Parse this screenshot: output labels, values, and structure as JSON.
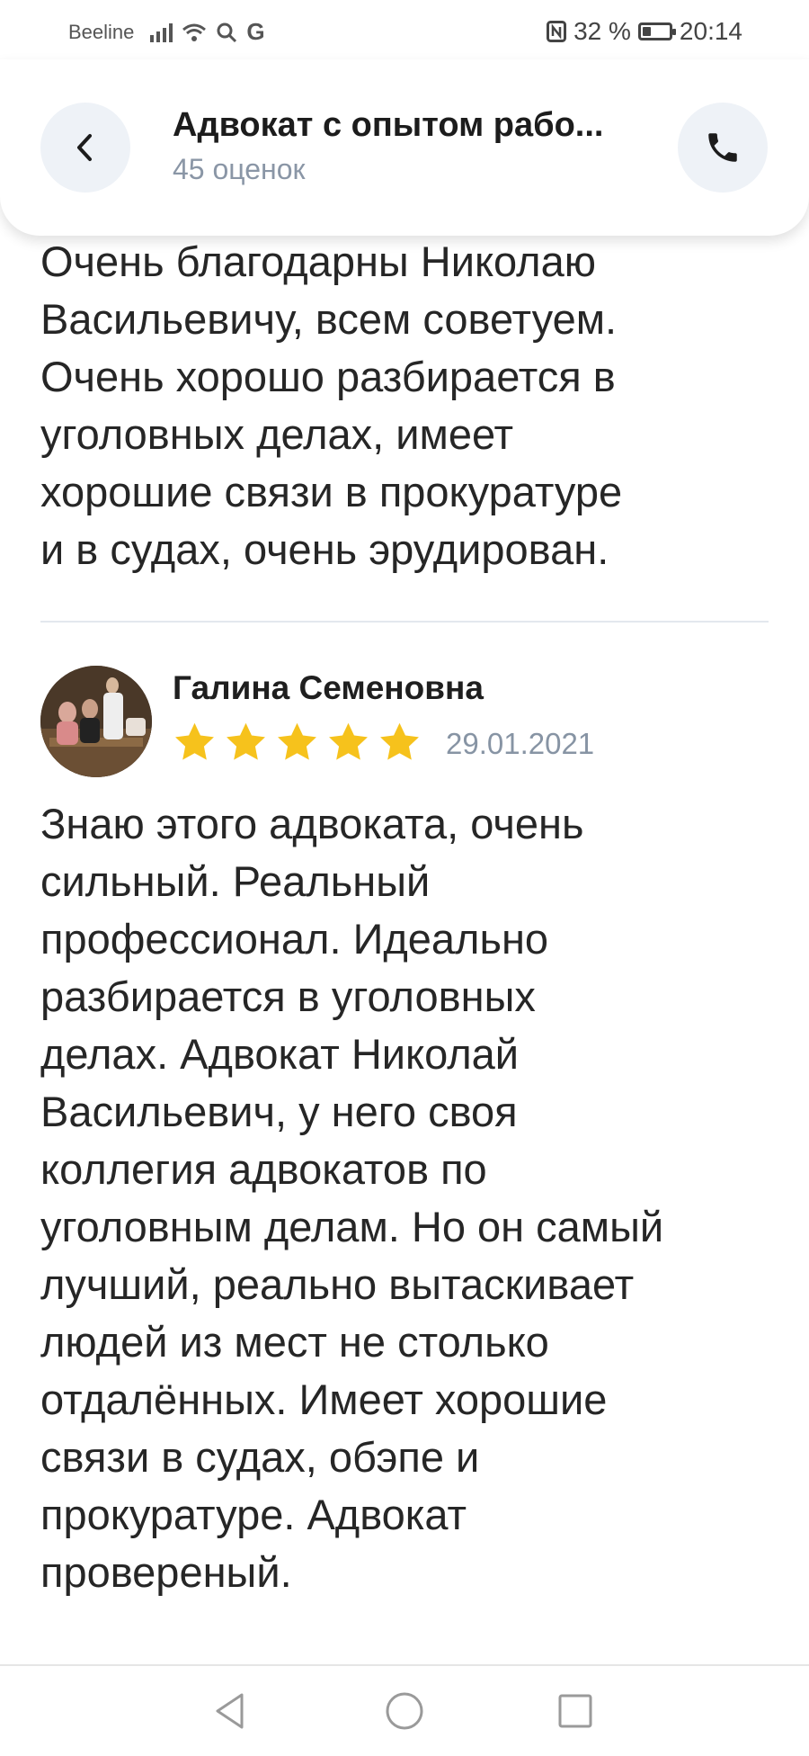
{
  "status_bar": {
    "carrier": "Beeline",
    "network_letter": "G",
    "battery": "32 %",
    "battery_level": 0.32,
    "time": "20:14"
  },
  "header": {
    "title": "Адвокат с опытом рабо...",
    "subtitle": "45 оценок"
  },
  "reviews": [
    {
      "text": "Очень благодарны Николаю\nВасильевичу, всем советуем.\nОчень хорошо разбирается в\nуголовных делах, имеет\nхорошие связи в прокуратуре\nи в судах, очень эрудирован."
    },
    {
      "author": "Галина Семеновна",
      "rating": 5,
      "date": "29.01.2021",
      "text": "Знаю этого адвоката, очень\nсильный. Реальный\nпрофессионал. Идеально\nразбирается в уголовных\nделах. Адвокат Николай\nВасильевич, у него своя\nколлегия адвокатов по\nуголовным делам. Но он самый\nлучший, реально вытаскивает\nлюдей из мест не столько\nотдалённых. Имеет хорошие\nсвязи в судах, обэпе и\nпрокуратуре. Адвокат\nпровереный."
    }
  ],
  "colors": {
    "star": "#f6c21c",
    "icon_button_bg": "#eef2f7",
    "muted_text": "#8a96a6"
  },
  "icons": [
    "signal-icon",
    "wifi-icon",
    "search-icon",
    "nfc-icon",
    "battery-icon",
    "back-arrow-icon",
    "phone-icon",
    "star-icon",
    "nav-back-icon",
    "nav-home-icon",
    "nav-recents-icon"
  ]
}
